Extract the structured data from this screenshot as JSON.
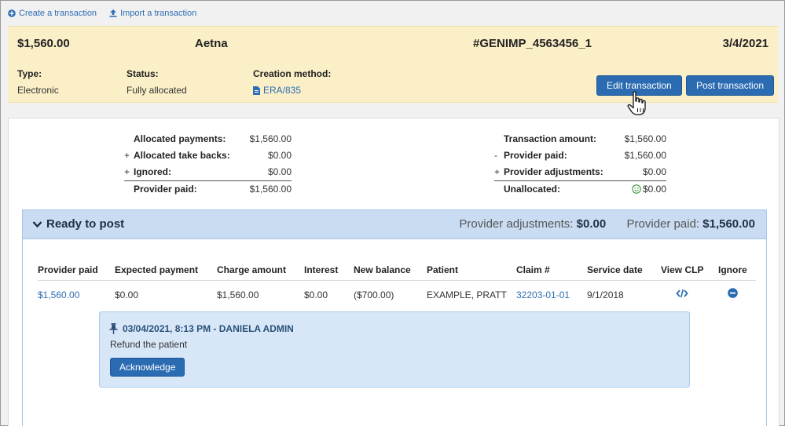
{
  "toolbar": {
    "create_label": "Create a transaction",
    "import_label": "Import a transaction"
  },
  "header": {
    "amount": "$1,560.00",
    "payer": "Aetna",
    "transaction_id": "#GENIMP_4563456_1",
    "date": "3/4/2021",
    "type_label": "Type:",
    "type_value": "Electronic",
    "status_label": "Status:",
    "status_value": "Fully allocated",
    "method_label": "Creation method:",
    "method_value": "ERA/835",
    "edit_button": "Edit transaction",
    "post_button": "Post transaction"
  },
  "summary_left": [
    {
      "op": "",
      "label": "Allocated payments:",
      "value": "$1,560.00"
    },
    {
      "op": "+",
      "label": "Allocated take backs:",
      "value": "$0.00"
    },
    {
      "op": "+",
      "label": "Ignored:",
      "value": "$0.00"
    },
    {
      "op": "",
      "label": "Provider paid:",
      "value": "$1,560.00"
    }
  ],
  "summary_right": [
    {
      "op": "",
      "label": "Transaction amount:",
      "value": "$1,560.00"
    },
    {
      "op": "-",
      "label": "Provider paid:",
      "value": "$1,560.00"
    },
    {
      "op": "+",
      "label": "Provider adjustments:",
      "value": "$0.00"
    },
    {
      "op": "",
      "label": "Unallocated:",
      "value": "$0.00"
    }
  ],
  "ready": {
    "title": "Ready to post",
    "adj_label": "Provider adjustments:",
    "adj_value": "$0.00",
    "paid_label": "Provider paid:",
    "paid_value": "$1,560.00"
  },
  "table": {
    "columns": [
      "Provider paid",
      "Expected payment",
      "Charge amount",
      "Interest",
      "New balance",
      "Patient",
      "Claim #",
      "Service date",
      "View CLP",
      "Ignore"
    ],
    "row": {
      "provider_paid": "$1,560.00",
      "expected_payment": "$0.00",
      "charge_amount": "$1,560.00",
      "interest": "$0.00",
      "new_balance": "($700.00)",
      "patient": "EXAMPLE, PRATT",
      "claim": "32203-01-01",
      "service_date": "9/1/2018"
    }
  },
  "note": {
    "title": "03/04/2021, 8:13 PM - DANIELA ADMIN",
    "text": "Refund the patient",
    "button": "Acknowledge"
  },
  "colors": {
    "accent": "#2b6bb2",
    "header_bg": "#fbefc7",
    "ready_bg": "#c9dcf2",
    "note_bg": "#d7e7f8",
    "success": "#3c9a3c"
  },
  "icons": {
    "create": "plus-circle-icon",
    "import": "upload-icon",
    "method": "file-icon",
    "ready": "chevron-down-icon",
    "note": "pin-icon",
    "unallocated": "smile-icon",
    "view_clp": "code-icon",
    "ignore": "minus-circle-icon",
    "cursor": "hand-pointer-icon"
  }
}
